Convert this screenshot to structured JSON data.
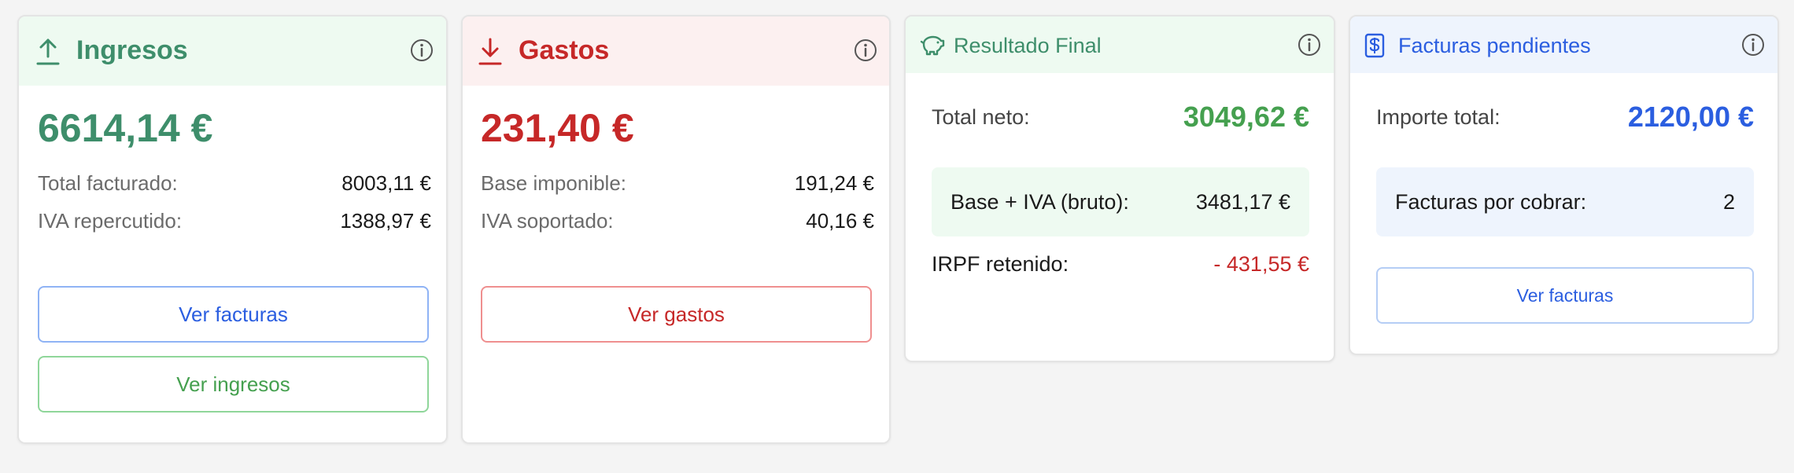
{
  "colors": {
    "green": "#3e8e6b",
    "green_text": "#45a04f",
    "red": "#c62828",
    "blue": "#2b5ee0",
    "green_header_bg": "#eefaf1",
    "red_header_bg": "#fcf0f0",
    "blue_header_bg": "#eef4fd",
    "box_green_bg": "#eefaf1",
    "box_blue_bg": "#eef4fd"
  },
  "ingresos": {
    "title": "Ingresos",
    "icon": "upload-icon",
    "amount": "6614,14 €",
    "rows": [
      {
        "label": "Total facturado:",
        "value": "8003,11 €"
      },
      {
        "label": "IVA repercutido:",
        "value": "1388,97 €"
      }
    ],
    "button_facturas": "Ver facturas",
    "button_ingresos": "Ver ingresos"
  },
  "gastos": {
    "title": "Gastos",
    "icon": "download-icon",
    "amount": "231,40 €",
    "rows": [
      {
        "label": "Base imponible:",
        "value": "191,24 €"
      },
      {
        "label": "IVA soportado:",
        "value": "40,16 €"
      }
    ],
    "button_gastos": "Ver gastos"
  },
  "resultado": {
    "title": "Resultado Final",
    "icon": "piggy-bank-icon",
    "total_label": "Total neto:",
    "total_value": "3049,62 €",
    "bruto_label": "Base + IVA (bruto):",
    "bruto_value": "3481,17 €",
    "irpf_label": "IRPF retenido:",
    "irpf_value": "- 431,55 €"
  },
  "pendientes": {
    "title": "Facturas pendientes",
    "icon": "invoice-dollar-icon",
    "importe_label": "Importe total:",
    "importe_value": "2120,00 €",
    "cobrar_label": "Facturas por cobrar:",
    "cobrar_value": "2",
    "button_facturas": "Ver facturas"
  }
}
